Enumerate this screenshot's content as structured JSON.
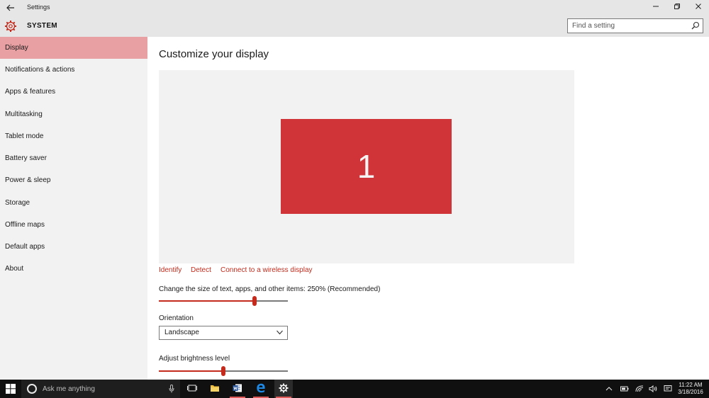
{
  "window": {
    "title": "Settings",
    "header_title": "SYSTEM"
  },
  "search": {
    "placeholder": "Find a setting"
  },
  "sidebar": {
    "items": [
      {
        "label": "Display",
        "active": true
      },
      {
        "label": "Notifications & actions"
      },
      {
        "label": "Apps & features"
      },
      {
        "label": "Multitasking"
      },
      {
        "label": "Tablet mode"
      },
      {
        "label": "Battery saver"
      },
      {
        "label": "Power & sleep"
      },
      {
        "label": "Storage"
      },
      {
        "label": "Offline maps"
      },
      {
        "label": "Default apps"
      },
      {
        "label": "About"
      }
    ]
  },
  "main": {
    "title": "Customize your display",
    "monitor_number": "1",
    "links": {
      "identify": "Identify",
      "detect": "Detect",
      "wireless": "Connect to a wireless display"
    },
    "scale": {
      "label": "Change the size of text, apps, and other items: 250% (Recommended)",
      "level": 0.74
    },
    "orientation": {
      "label": "Orientation",
      "selected": "Landscape"
    },
    "brightness": {
      "label": "Adjust brightness level",
      "level": 0.5
    }
  },
  "taskbar": {
    "search_placeholder": "Ask me anything",
    "apps": [
      "task-view-icon",
      "file-explorer-icon",
      "word-icon",
      "edge-icon",
      "settings-icon"
    ],
    "clock_time": "11:22 AM",
    "clock_date": "3/18/2016"
  },
  "colors": {
    "accent": "#c42b1c",
    "monitor": "#d13438",
    "active_nav": "#e8a0a3",
    "sidebar_bg": "#f2f2f2",
    "taskbar_bg": "#101010"
  }
}
